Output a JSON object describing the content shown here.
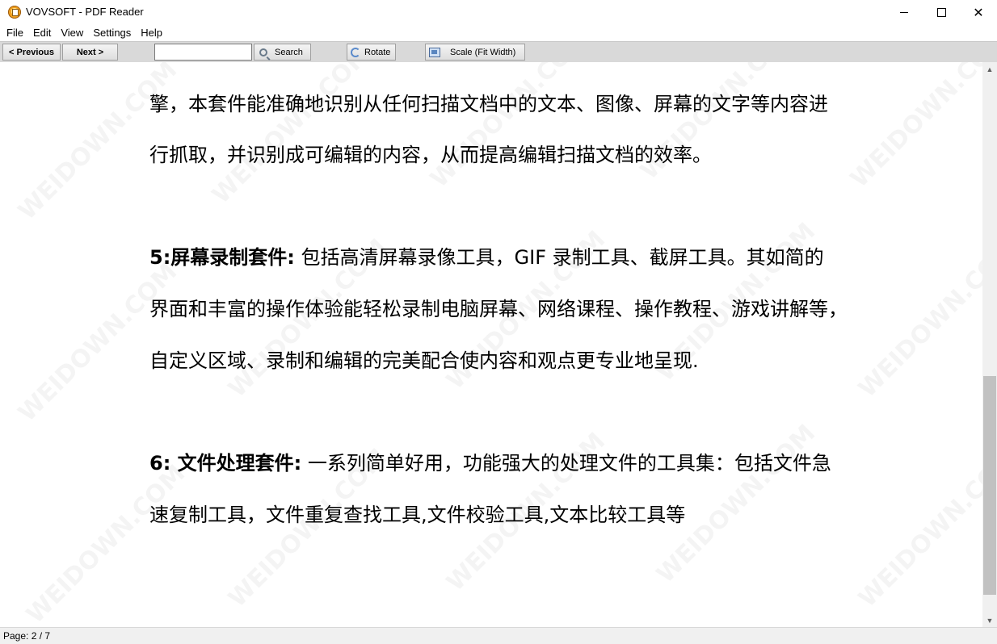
{
  "window": {
    "title": "VOVSOFT - PDF Reader",
    "controls": {
      "minimize_icon": "minimize-icon",
      "maximize_icon": "maximize-icon",
      "close_icon": "close-icon",
      "close_glyph": "✕"
    }
  },
  "menu": {
    "items": [
      {
        "label": "File"
      },
      {
        "label": "Edit"
      },
      {
        "label": "View"
      },
      {
        "label": "Settings"
      },
      {
        "label": "Help"
      }
    ]
  },
  "toolbar": {
    "previous_label": "< Previous",
    "next_label": "Next >",
    "search_value": "",
    "search_label": "Search",
    "rotate_label": "Rotate",
    "scale_label": "Scale (Fit Width)"
  },
  "document": {
    "lines": [
      {
        "text": "擎，本套件能准确地识别从任何扫描文档中的文本、图像、屏幕的文字等内容进"
      },
      {
        "text": "行抓取，并识别成可编辑的内容，从而提高编辑扫描文档的效率。"
      },
      {
        "bold": "5:屏幕录制套件:",
        "text": " 包括高清屏幕录像工具，GIF 录制工具、截屏工具。其如简的"
      },
      {
        "text": "界面和丰富的操作体验能轻松录制电脑屏幕、网络课程、操作教程、游戏讲解等，"
      },
      {
        "text": "自定义区域、录制和编辑的完美配合使内容和观点更专业地呈现."
      },
      {
        "bold": "6:  文件处理套件:",
        "text": " 一系列简单好用，功能强大的处理文件的工具集：包括文件急"
      },
      {
        "text": "速复制工具，文件重复查找工具,文件校验工具,文本比较工具等"
      }
    ],
    "watermark": "WEIDOWN.COM"
  },
  "status": {
    "page_text": "Page: 2 / 7"
  }
}
